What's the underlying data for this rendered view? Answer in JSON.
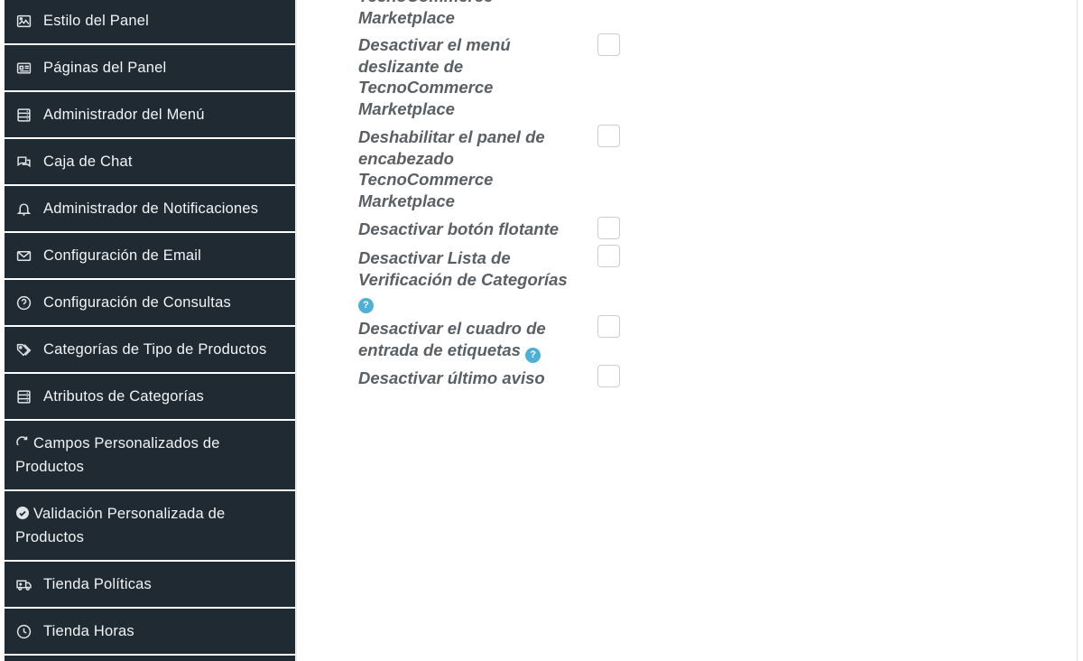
{
  "sidebar": {
    "items": [
      {
        "label": "Estilo del Panel",
        "icon": "image-icon"
      },
      {
        "label": "Páginas del Panel",
        "icon": "newspaper-icon"
      },
      {
        "label": "Administrador del Menú",
        "icon": "menu-server-icon"
      },
      {
        "label": "Caja de Chat",
        "icon": "chat-icon"
      },
      {
        "label": "Administrador de Notificaciones",
        "icon": "bell-icon"
      },
      {
        "label": "Configuración de Email",
        "icon": "envelope-icon"
      },
      {
        "label": "Configuración de Consultas",
        "icon": "question-circle-icon"
      },
      {
        "label": "Categorías de Tipo de Productos",
        "icon": "tags-icon"
      },
      {
        "label": "Atributos de Categorías",
        "icon": "server-icon"
      },
      {
        "label": "Campos Personalizados de Productos",
        "icon": "refresh-icon"
      },
      {
        "label": "Validación Personalizada de Productos",
        "icon": "badge-check-icon"
      },
      {
        "label": "Tienda Políticas",
        "icon": "truck-icon"
      },
      {
        "label": "Tienda Horas",
        "icon": "clock-icon"
      }
    ]
  },
  "settings": {
    "partial_top": "TecnoCommerce Marketplace",
    "rows": [
      {
        "label": "Desactivar el menú deslizante de TecnoCommerce Marketplace",
        "checked": false
      },
      {
        "label": "Deshabilitar el panel de encabezado TecnoCommerce Marketplace",
        "checked": false
      },
      {
        "label": "Desactivar botón flotante",
        "checked": false
      },
      {
        "label": "Desactivar Lista de Verificación de Categorías",
        "checked": false,
        "help": true
      },
      {
        "label": "Desactivar el cuadro de entrada de etiquetas",
        "checked": false,
        "help": true
      },
      {
        "label": "Desactivar último aviso",
        "checked": false
      }
    ],
    "help_glyph": "?"
  }
}
